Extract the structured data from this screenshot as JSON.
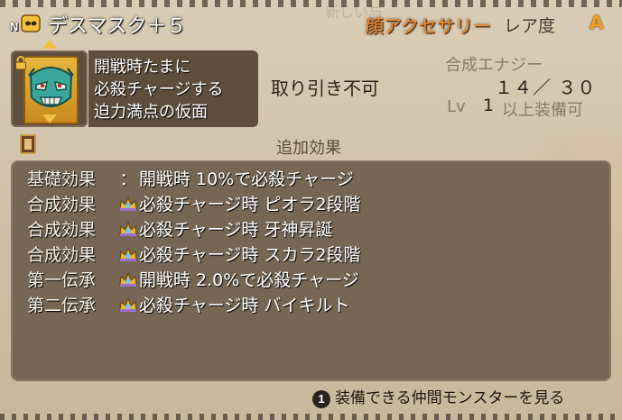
{
  "header": {
    "badge": "N",
    "item_name": "デスマスク＋５",
    "category": "顔アクセサリー",
    "rarity_label": "レア度",
    "rarity_value": "A",
    "background_text": "新しい与"
  },
  "item": {
    "icon": "death-mask-icon",
    "description": [
      "開戦時たまに",
      "必殺チャージする",
      "迫力満点の仮面"
    ],
    "trade": "取り引き不可",
    "synth_label": "合成エナジー",
    "synth_value": "１４／ ３０",
    "lv_label": "Lv",
    "lv_value": "1",
    "lv_suffix": "以上装備可"
  },
  "effects": {
    "title": "追加効果",
    "rows": [
      {
        "label": "基礎効果",
        "separator": "：",
        "text": "開戦時 10%で必殺チャージ"
      },
      {
        "label": "合成効果",
        "icon": "crown-icon",
        "text": "必殺チャージ時 ピオラ2段階"
      },
      {
        "label": "合成効果",
        "icon": "crown-icon",
        "text": "必殺チャージ時 牙神昇誕"
      },
      {
        "label": "合成効果",
        "icon": "crown-icon",
        "text": "必殺チャージ時 スカラ2段階"
      },
      {
        "label": "第一伝承",
        "icon": "crown-icon",
        "text": "開戦時 2.0%で必殺チャージ"
      },
      {
        "label": "第二伝承",
        "icon": "crown-icon",
        "text": "必殺チャージ時 バイキルト"
      }
    ]
  },
  "footer": {
    "button": "1",
    "label": "装備できる仲間モンスターを見る"
  },
  "colors": {
    "category": "#ef8a2d",
    "rarity": "#f0a020",
    "panel": "#766656"
  }
}
